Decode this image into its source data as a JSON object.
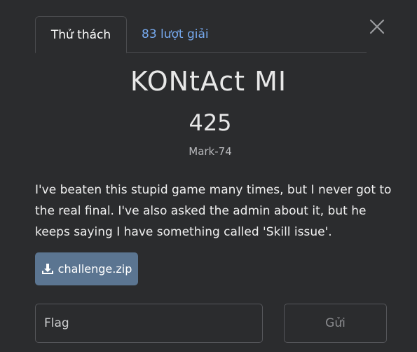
{
  "tabs": {
    "challenge_label": "Thử thách",
    "solves_label": "83 lượt giải"
  },
  "challenge": {
    "name": "KONtAct MI",
    "points": "425",
    "author": "Mark-74",
    "description": "I've beaten this stupid game many times, but I never got to the real final. I've also asked the admin about it, but he keeps saying I have something called 'Skill issue'."
  },
  "files": {
    "download_label": "challenge.zip"
  },
  "flag_form": {
    "placeholder": "Flag",
    "submit_label": "Gửi"
  },
  "icons": {
    "close": "close-icon",
    "download": "download-icon"
  },
  "colors": {
    "background": "#2b2c2e",
    "link_blue": "#76a9ee",
    "download_button": "#5b7591"
  }
}
